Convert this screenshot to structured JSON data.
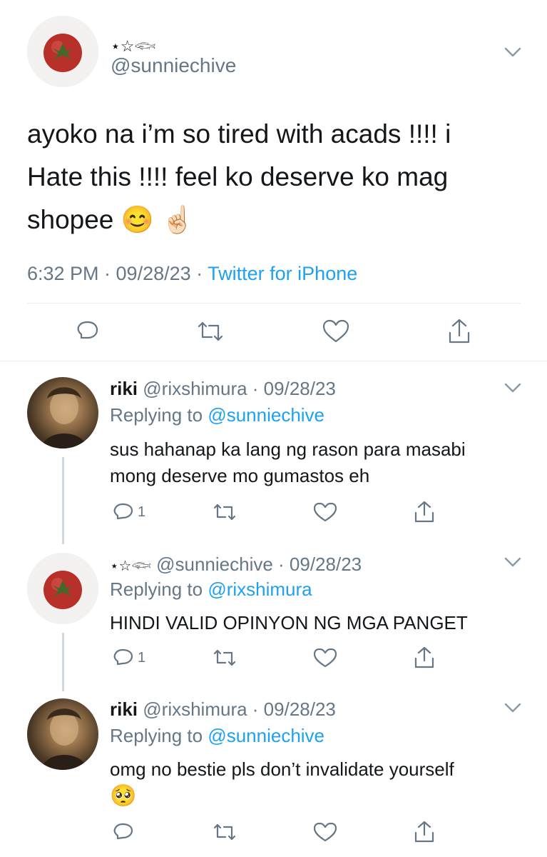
{
  "main_tweet": {
    "display_name": "⋆☆𓆟",
    "handle": "@sunniechive",
    "text_line1": "ayoko na i’m so tired with acads !!!! i",
    "text_line2": "Hate this !!!! feel ko deserve ko mag",
    "text_line3": "shopee",
    "emoji": "😊 ☝🏻",
    "time": "6:32 PM · 09/28/23 · ",
    "source": "Twitter for iPhone"
  },
  "replies": [
    {
      "name": "riki",
      "meta": "@rixshimura · 09/28/23",
      "replying_prefix": "Replying to ",
      "replying_to": "@sunniechive",
      "text_line1": "sus hahanap ka lang ng rason para masabi",
      "text_line2": "mong deserve mo gumastos eh",
      "reply_count": "1"
    },
    {
      "name": "⋆☆𓆟",
      "meta": "@sunniechive · 09/28/23",
      "replying_prefix": "Replying to ",
      "replying_to": "@rixshimura",
      "text_line1": "HINDI VALID OPINYON NG MGA PANGET",
      "reply_count": "1"
    },
    {
      "name": "riki",
      "meta": "@rixshimura · 09/28/23",
      "replying_prefix": "Replying to ",
      "replying_to": "@sunniechive",
      "text_line1": "omg no bestie pls don’t invalidate yourself",
      "emoji": "🥺"
    }
  ],
  "icons": [
    "chevron-down-icon",
    "reply-icon",
    "retweet-icon",
    "like-icon",
    "share-icon"
  ],
  "colors": {
    "link": "#1da1f2",
    "secondary": "#657786",
    "divider": "#e6ecf0"
  }
}
